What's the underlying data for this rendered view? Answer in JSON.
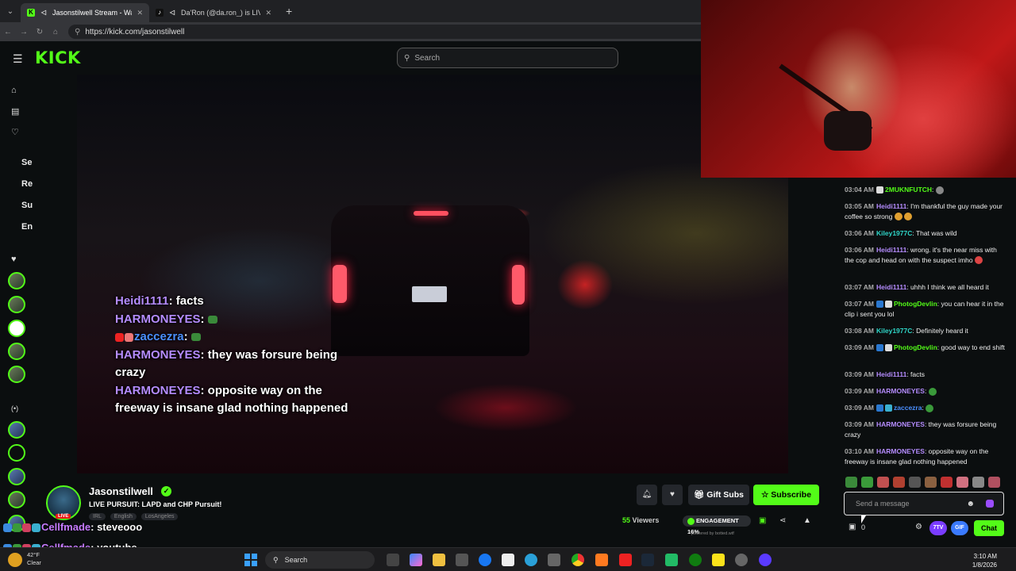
{
  "browser": {
    "tabs": [
      {
        "label": "Jasonstilwell Stream - Watch",
        "active": true,
        "icon": "kick-favicon"
      },
      {
        "label": "Da'Ron (@da.ron_) is LIVE - Ti",
        "active": false,
        "icon": "tiktok-favicon"
      }
    ],
    "url": "https://kick.com/jasonstilwell"
  },
  "kick": {
    "logo": "KICK",
    "search_placeholder": "Search",
    "sidebar": {
      "nav_icons": [
        "home-icon",
        "browse-icon",
        "following-icon"
      ],
      "section_letters": [
        "Se",
        "Re",
        "Su",
        "En"
      ]
    }
  },
  "video_overlay": {
    "lines": [
      {
        "user": "Heidi1111",
        "text": ": facts"
      },
      {
        "user": "HARMONEYES",
        "text": ":"
      },
      {
        "user": "zaccezra",
        "text": ":"
      },
      {
        "user": "HARMONEYES",
        "text": ": they was forsure being crazy"
      },
      {
        "user": "HARMONEYES",
        "text": ": opposite way on the freeway is insane glad nothing happened"
      }
    ]
  },
  "chat": {
    "messages": [
      {
        "time": "03:04 AM",
        "user": "2MUKNFUTCH",
        "text": ":",
        "color": "#53fc18"
      },
      {
        "time": "03:05 AM",
        "user": "Heidi1111",
        "text": ": I'm thankful the guy made your coffee so strong",
        "color": "#b58cff"
      },
      {
        "time": "03:06 AM",
        "user": "Kiley1977C",
        "text": ": That was wild",
        "color": "#2fd6c8"
      },
      {
        "time": "03:06 AM",
        "user": "Heidi1111",
        "text": ": wrong. it's the near miss with the cop and head on with the suspect imho",
        "color": "#b58cff"
      },
      {
        "time": "03:07 AM",
        "user": "Heidi1111",
        "text": ": uhhh I think we all heard it",
        "color": "#b58cff"
      },
      {
        "time": "03:07 AM",
        "user": "PhotogDevlin",
        "text": ": you can hear it in the clip i sent you lol",
        "color": "#53fc18"
      },
      {
        "time": "03:08 AM",
        "user": "Kiley1977C",
        "text": ": Definitely heard it",
        "color": "#2fd6c8"
      },
      {
        "time": "03:09 AM",
        "user": "PhotogDevlin",
        "text": ": good way to end shift",
        "color": "#53fc18"
      },
      {
        "time": "03:09 AM",
        "user": "Heidi1111",
        "text": ": facts",
        "color": "#b58cff"
      },
      {
        "time": "03:09 AM",
        "user": "HARMONEYES",
        "text": ":",
        "color": "#b58cff"
      },
      {
        "time": "03:09 AM",
        "user": "zaccezra",
        "text": ":",
        "color": "#4a8fff"
      },
      {
        "time": "03:09 AM",
        "user": "HARMONEYES",
        "text": ": they was forsure being crazy",
        "color": "#b58cff"
      },
      {
        "time": "03:10 AM",
        "user": "HARMONEYES",
        "text": ": opposite way on the freeway is insane glad nothing happened",
        "color": "#b58cff"
      }
    ],
    "input_placeholder": "Send a message",
    "store_count": "0",
    "pill_7tv": "7TV",
    "pill_gif": "GIF",
    "chat_button": "Chat"
  },
  "streamer": {
    "name": "Jasonstilwell",
    "live_tag": "LIVE",
    "title": "LIVE PURSUIT: LAPD and CHP Pursuit!",
    "tags": [
      "IRL",
      "English",
      "LosAngeles"
    ],
    "gift_button": "Gift Subs",
    "subscribe_button": "Subscribe",
    "viewers_count": "55",
    "viewers_label": "Viewers",
    "engagement_label": "ENGAGEMENT",
    "engagement_value": "16%",
    "powered_by": "powered by botted.wtf"
  },
  "lower_chat": [
    {
      "user": "Cellfmade",
      "text": ": steveooo"
    },
    {
      "user": "Cellfmade",
      "text": ": youtube"
    }
  ],
  "taskbar": {
    "temperature": "42°F",
    "condition": "Clear",
    "search_label": "Search",
    "time": "3:10 AM",
    "date": "1/8/2026"
  }
}
